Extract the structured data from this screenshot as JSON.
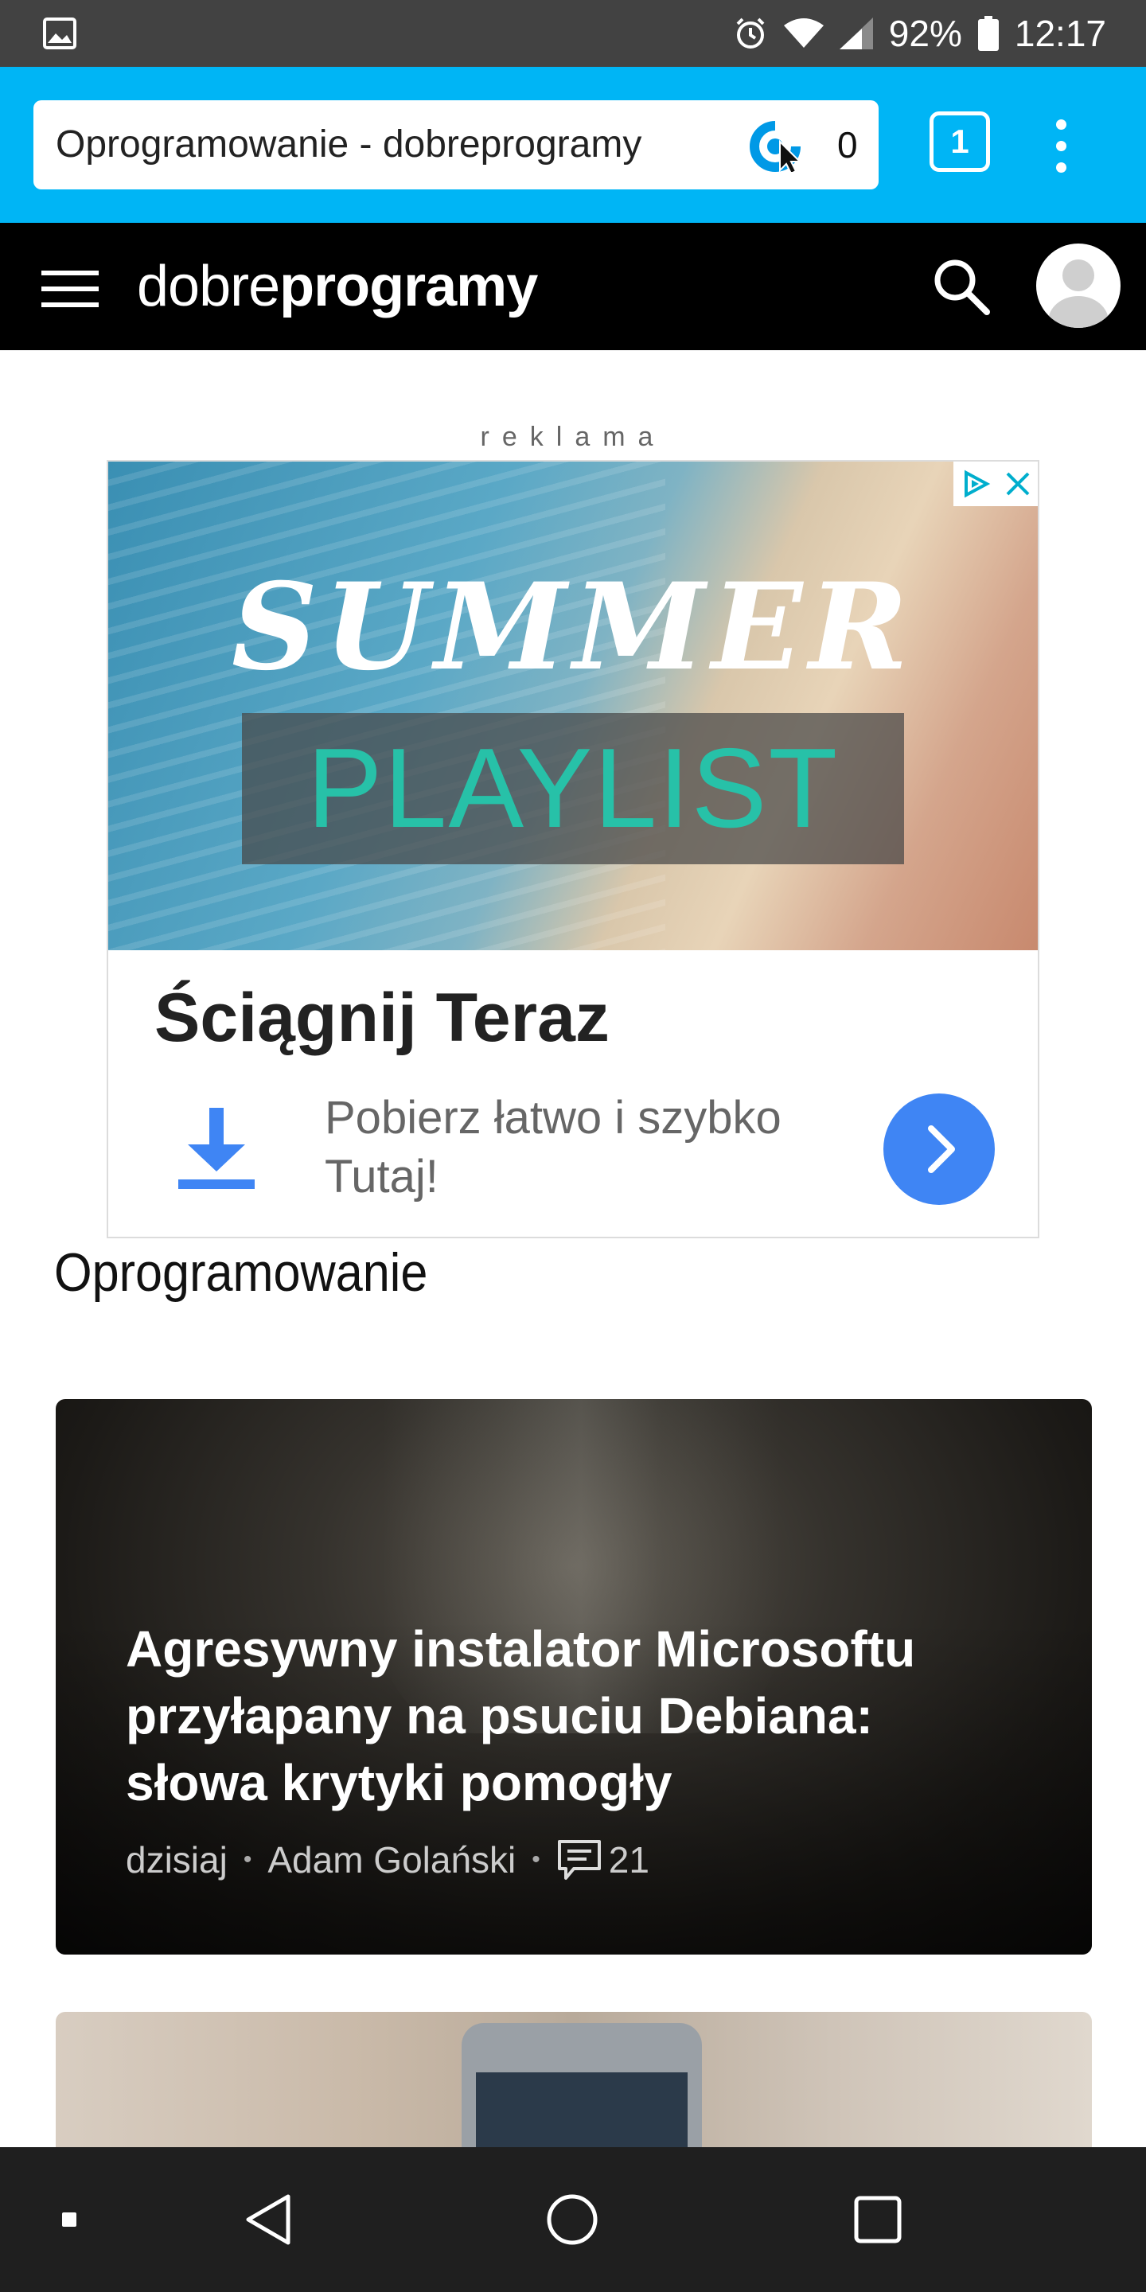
{
  "status_bar": {
    "battery": "92%",
    "time": "12:17"
  },
  "browser": {
    "url_text": "Oprogramowanie - dobreprogramy",
    "counter": "0",
    "tabs_count": "1"
  },
  "site": {
    "logo_light": "dobre",
    "logo_bold": "programy"
  },
  "ad": {
    "label": "reklama",
    "image_title": "SUMMER",
    "image_subtitle": "PLAYLIST",
    "headline": "Ściągnij Teraz",
    "description": "Pobierz łatwo i szybko Tutaj!"
  },
  "section": {
    "title": "Oprogramowanie"
  },
  "articles": [
    {
      "title": "Agresywny instalator Microsoftu przyłapany na psuciu Debiana: słowa krytyki pomogły",
      "date": "dzisiaj",
      "author": "Adam Golański",
      "comments": "21"
    }
  ],
  "colors": {
    "toolbar": "#00b5f5",
    "header": "#000000",
    "ad_button": "#3f85f4",
    "playlist_text": "#27c1a8"
  }
}
